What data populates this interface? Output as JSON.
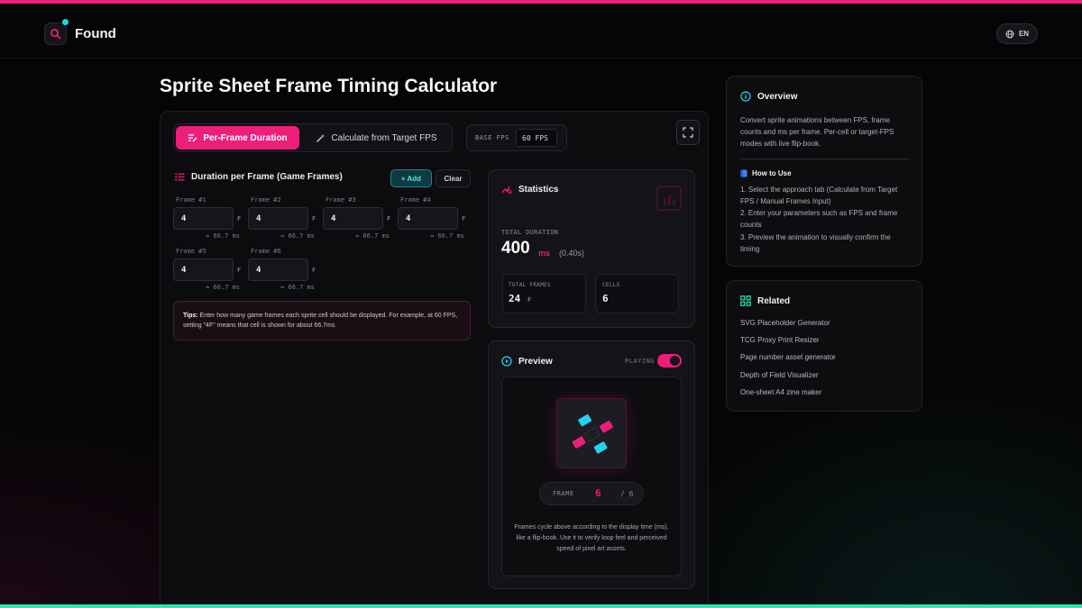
{
  "header": {
    "brand": "Found",
    "lang": "EN"
  },
  "page": {
    "title": "Sprite Sheet Frame Timing Calculator"
  },
  "tabs": [
    {
      "label": "Per-Frame Duration",
      "active": true
    },
    {
      "label": "Calculate from Target FPS",
      "active": false
    }
  ],
  "base_fps": {
    "label": "BASE FPS",
    "value": "60 FPS"
  },
  "durations": {
    "title": "Duration per Frame (Game Frames)",
    "add_label": "+ Add",
    "clear_label": "Clear",
    "unit": "F",
    "frames": [
      {
        "label": "Frame #1",
        "value": "4",
        "ms": "≈ 66.7 ms"
      },
      {
        "label": "Frame #2",
        "value": "4",
        "ms": "≈ 66.7 ms"
      },
      {
        "label": "Frame #3",
        "value": "4",
        "ms": "≈ 66.7 ms"
      },
      {
        "label": "Frame #4",
        "value": "4",
        "ms": "≈ 66.7 ms"
      },
      {
        "label": "Frame #5",
        "value": "4",
        "ms": "≈ 66.7 ms"
      },
      {
        "label": "Frame #6",
        "value": "4",
        "ms": "≈ 66.7 ms"
      }
    ],
    "tips_label": "Tips:",
    "tips_text": " Enter how many game frames each sprite cell should be displayed. For example, at 60 FPS, setting \"4F\" means that cell is shown for about 66.7ms."
  },
  "statistics": {
    "title": "Statistics",
    "total_duration_label": "TOTAL DURATION",
    "total_duration_value": "400",
    "total_duration_unit": "ms",
    "total_duration_seconds": "(0.40s)",
    "total_frames_label": "TOTAL FRAMES",
    "total_frames_value": "24",
    "total_frames_unit": "F",
    "cells_label": "CELLS",
    "cells_value": "6"
  },
  "preview": {
    "title": "Preview",
    "playing_label": "PLAYING",
    "playing": true,
    "frame_label": "FRAME",
    "frame_current": "6",
    "frame_total": "/ 6",
    "description": "Frames cycle above according to the display time (ms), like a flip-book. Use it to verify loop feel and perceived speed of pixel art assets."
  },
  "overview": {
    "title": "Overview",
    "text": "Convert sprite animations between FPS, frame counts and ms per frame. Per-cell or target-FPS modes with live flip-book.",
    "howto_title": "How to Use",
    "steps": [
      "1. Select the approach tab (Calculate from Target FPS / Manual Frames Input)",
      "2. Enter your parameters such as FPS and frame counts",
      "3. Preview the animation to visually confirm the timing"
    ]
  },
  "related": {
    "title": "Related",
    "links": [
      "SVG Placeholder Generator",
      "TCG Proxy Print Resizer",
      "Page number asset generator",
      "Depth of Field Visualizer",
      "One-sheet A4 zine maker"
    ]
  },
  "colors": {
    "accent": "#ec1f7a",
    "cyan": "#22d3ee",
    "green": "#2ee6b4",
    "background": "#050506"
  }
}
